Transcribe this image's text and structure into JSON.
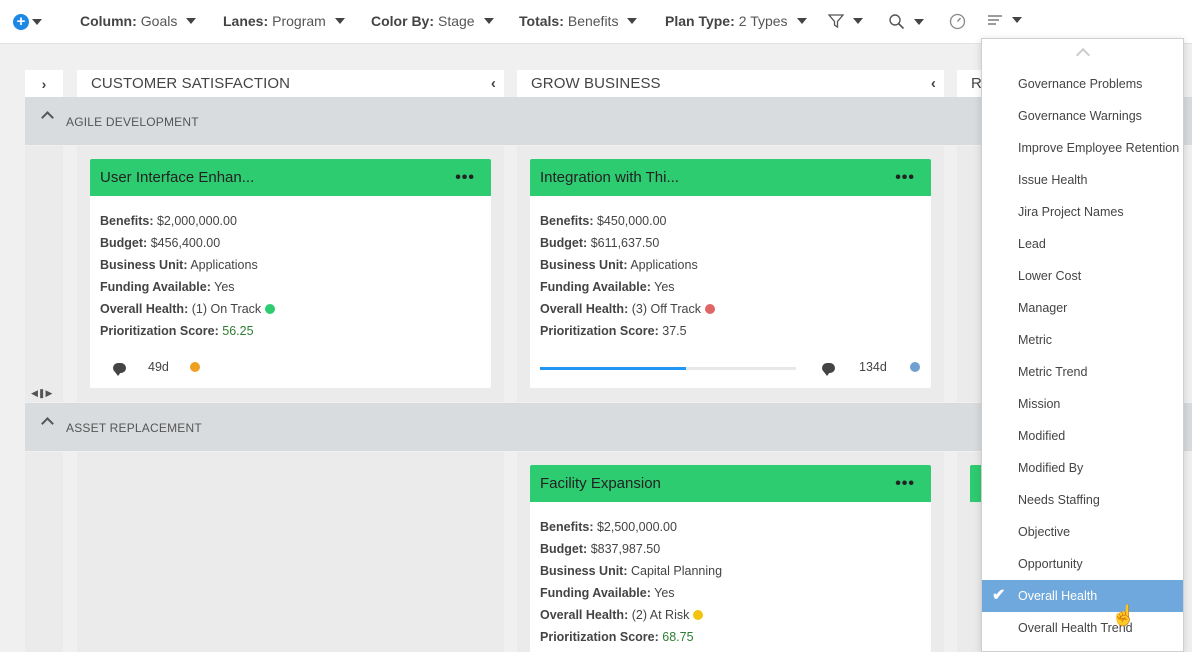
{
  "toolbar": {
    "column_label": "Column:",
    "column_value": "Goals",
    "lanes_label": "Lanes:",
    "lanes_value": "Program",
    "color_label": "Color By:",
    "color_value": "Stage",
    "totals_label": "Totals:",
    "totals_value": "Benefits",
    "plantype_label": "Plan Type:",
    "plantype_value": "2 Types",
    "icons": [
      "add-icon",
      "filter-icon",
      "search-icon",
      "gauge-icon",
      "list-icon"
    ]
  },
  "columns": [
    {
      "title": "CUSTOMER SATISFACTION"
    },
    {
      "title": "GROW BUSINESS"
    },
    {
      "title": "R"
    }
  ],
  "lanes": [
    {
      "title": "AGILE DEVELOPMENT"
    },
    {
      "title": "ASSET REPLACEMENT"
    }
  ],
  "cards": [
    {
      "title": "User Interface Enhan...",
      "benefits_label": "Benefits:",
      "benefits": "$2,000,000.00",
      "budget_label": "Budget:",
      "budget": "$456,400.00",
      "bu_label": "Business Unit:",
      "bu": "Applications",
      "funding_label": "Funding Available:",
      "funding": "Yes",
      "health_label": "Overall Health:",
      "health": "(1) On Track",
      "health_color": "#2ecc71",
      "score_label": "Prioritization Score:",
      "score": "56.25",
      "days": "49d",
      "status_color": "#f0a020"
    },
    {
      "title": "Integration with Thi...",
      "benefits_label": "Benefits:",
      "benefits": "$450,000.00",
      "budget_label": "Budget:",
      "budget": "$611,637.50",
      "bu_label": "Business Unit:",
      "bu": "Applications",
      "funding_label": "Funding Available:",
      "funding": "Yes",
      "health_label": "Overall Health:",
      "health": "(3) Off Track",
      "health_color": "#e06666",
      "score_label": "Prioritization Score:",
      "score": "37.5",
      "days": "134d",
      "status_color": "#6fa0d0",
      "progress": 0.57
    },
    {
      "title": "Facility Expansion",
      "benefits_label": "Benefits:",
      "benefits": "$2,500,000.00",
      "budget_label": "Budget:",
      "budget": "$837,987.50",
      "bu_label": "Business Unit:",
      "bu": "Capital Planning",
      "funding_label": "Funding Available:",
      "funding": "Yes",
      "health_label": "Overall Health:",
      "health": "(2) At Risk",
      "health_color": "#f1c40f",
      "score_label": "Prioritization Score:",
      "score": "68.75"
    }
  ],
  "dropdown": {
    "items": [
      "Governance Problems",
      "Governance Warnings",
      "Improve Employee Retention",
      "Issue Health",
      "Jira Project Names",
      "Lead",
      "Lower Cost",
      "Manager",
      "Metric",
      "Metric Trend",
      "Mission",
      "Modified",
      "Modified By",
      "Needs Staffing",
      "Objective",
      "Opportunity",
      "Overall Health",
      "Overall Health Trend"
    ],
    "selected": "Overall Health"
  },
  "colors": {
    "card_header": "#2ecc71",
    "selected_item": "#6fa8dc",
    "add_button": "#1e88e5"
  }
}
